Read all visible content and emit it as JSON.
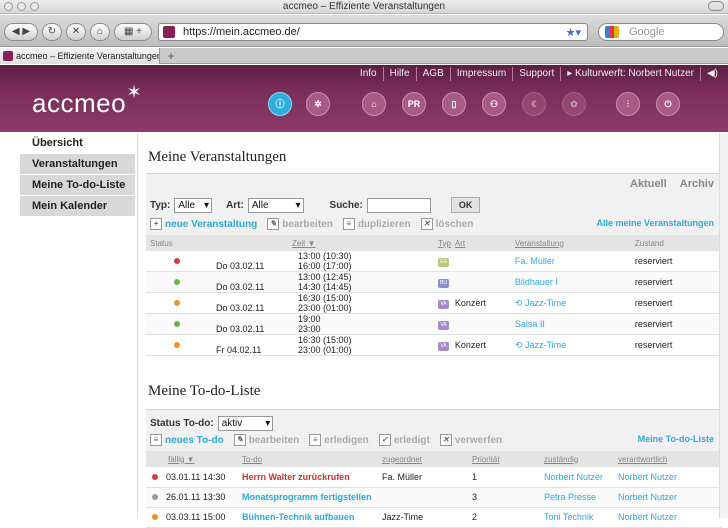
{
  "window": {
    "title": "accmeo – Effiziente Veranstaltungen"
  },
  "browser": {
    "url": "https://mein.accmeo.de/",
    "search_placeholder": "Google",
    "tab_title": "accmeo – Effiziente Veranstaltungen",
    "new_tab": "+"
  },
  "header": {
    "logo": "accmeo",
    "topnav": [
      "Info",
      "Hilfe",
      "AGB",
      "Impressum",
      "Support",
      "▸ Kulturwerft: Norbert Nutzer",
      "◀︎)"
    ],
    "icons": [
      "info-icon",
      "wand-icon",
      "home-icon",
      "pr-icon",
      "phone-icon",
      "people-icon",
      "euro-icon",
      "settings-icon",
      "sliders-icon",
      "power-icon"
    ],
    "icon_labels": [
      "ⓘ",
      "✲",
      "⌂",
      "PR",
      "▯",
      "⚇",
      "€",
      "✿",
      "⫶",
      "⏻"
    ]
  },
  "sidebar": {
    "items": [
      "Übersicht",
      "Veranstaltungen",
      "Meine To-do-Liste",
      "Mein Kalender"
    ]
  },
  "events": {
    "title": "Meine Veranstaltungen",
    "view_tabs": [
      "Aktuell",
      "Archiv"
    ],
    "filter_type_label": "Typ:",
    "filter_type_value": "Alle",
    "filter_art_label": "Art:",
    "filter_art_value": "Alle",
    "search_label": "Suche:",
    "ok": "OK",
    "actions": [
      "neue Veranstaltung",
      "bearbeiten",
      "duplizieren",
      "löschen"
    ],
    "all_link": "Alle meine Veranstaltungen",
    "columns": [
      "Status",
      "Zeit ▼",
      "Typ",
      "Art",
      "Veranstaltung",
      "Zustand"
    ],
    "rows": [
      {
        "status_color": "#e03a3a",
        "day": "Do 03.02.11",
        "time1": "13:00 (10:30)",
        "time2": "16:00 (17:00)",
        "typ": "GS",
        "typ_color": "#b9c97a",
        "art": "",
        "name": "Fa. Müller",
        "zustand": "reserviert"
      },
      {
        "status_color": "#5fb848",
        "day": "Do 03.02.11",
        "time1": "13:00 (12:45)",
        "time2": "14:30 (14:45)",
        "typ": "BU",
        "typ_color": "#8b8fc9",
        "art": "",
        "name": "Bildhauer I",
        "zustand": "reserviert"
      },
      {
        "status_color": "#f0922a",
        "day": "Do 03.02.11",
        "time1": "16:30 (15:00)",
        "time2": "23:00 (01:00)",
        "typ": "VA",
        "typ_color": "#a58bc9",
        "art": "Konzert",
        "name": "⟲ Jazz-Time",
        "zustand": "reserviert"
      },
      {
        "status_color": "#5fb848",
        "day": "Do 03.02.11",
        "time1": "19:00",
        "time2": "23:00",
        "typ": "VA",
        "typ_color": "#a58bc9",
        "art": "",
        "name": "Salsa II",
        "zustand": "reserviert"
      },
      {
        "status_color": "#f0922a",
        "day": "Fr 04.02.11",
        "time1": "16:30 (15:00)",
        "time2": "23:00 (01:00)",
        "typ": "VA",
        "typ_color": "#a58bc9",
        "art": "Konzert",
        "name": "⟲ Jazz-Time",
        "zustand": "reserviert"
      }
    ]
  },
  "todo": {
    "title": "Meine To-do-Liste",
    "status_label": "Status To-do:",
    "status_value": "aktiv",
    "actions": [
      "neues To-do",
      "bearbeiten",
      "erledigen",
      "erledigt",
      "verwerfen"
    ],
    "all_link": "Meine To-do-Liste",
    "columns": [
      "fällig ▼",
      "To-do",
      "zugeordnet",
      "Priorität",
      "zuständig",
      "verantwortlich"
    ],
    "rows": [
      {
        "status_color": "#e03a3a",
        "due": "03.01.11 14:30",
        "task": "Herrn Walter zurückrufen",
        "task_class": "red",
        "assigned": "Fa. Müller",
        "prio": "1",
        "resp": "Norbert Nutzer",
        "accountable": "Norbert Nutzer"
      },
      {
        "status_color": "#9a9a9a",
        "due": "26.01.11 13:30",
        "task": "Monatsprogramm fertigstellen",
        "task_class": "link",
        "assigned": "",
        "prio": "3",
        "resp": "Petra Presse",
        "accountable": "Norbert Nutzer"
      },
      {
        "status_color": "#f0922a",
        "due": "03.03.11 15:00",
        "task": "Bühnen-Technik aufbauen",
        "task_class": "link",
        "assigned": "Jazz-Time",
        "prio": "2",
        "resp": "Toni Technik",
        "accountable": "Norbert Nutzer"
      }
    ]
  }
}
